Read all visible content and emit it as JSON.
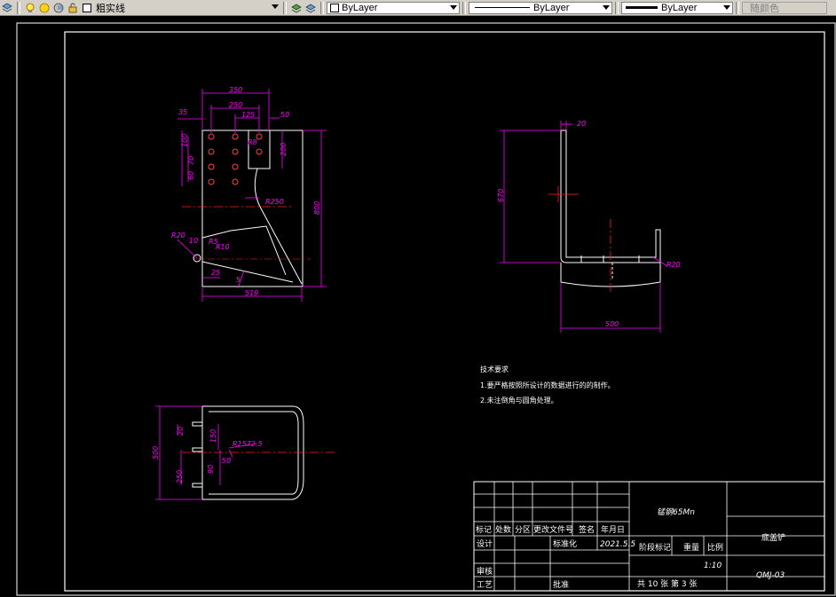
{
  "toolbar": {
    "linetype_name": "粗实线",
    "color_control": "ByLayer",
    "linetype_control": "ByLayer",
    "lineweight_control": "ByLayer",
    "plotstyle_control": "随颜色"
  },
  "view1": {
    "dims": {
      "d350": "350",
      "d250": "250",
      "d125": "125",
      "d50": "50",
      "d35": "35",
      "d100": "100",
      "d70": "70",
      "d60": "60",
      "d200": "200",
      "d800": "800",
      "d519": "519",
      "d25": "25",
      "d10": "10",
      "d5": "5",
      "r20": "R20",
      "r5": "R5",
      "r8": "R8",
      "r10": "R10",
      "r250": "R250"
    }
  },
  "view2": {
    "dims": {
      "d20": "20",
      "d670": "670",
      "d500": "500",
      "r20": "R20"
    }
  },
  "view3": {
    "dims": {
      "d500": "500",
      "d20": "20",
      "d150": "150",
      "d90": "90",
      "d250": "250",
      "d50": "50",
      "r": "R1572.5"
    }
  },
  "notes": {
    "title": "技术要求",
    "line1": "1.要严格按照所设计的数据进行的的制作。",
    "line2": "2.未注倒角与圆角处理。"
  },
  "titleblock": {
    "material": "锰钢65Mn",
    "part_name": "底盖铲",
    "drawing_no": "QMJ-03",
    "h_mark": "标记",
    "h_count": "处数",
    "h_zone": "分区",
    "h_docno": "更改文件号",
    "h_sign": "签名",
    "h_date": "年月日",
    "h_design": "设计",
    "h_standard": "标准化",
    "design_date": "2021.5.5",
    "h_stage": "阶段标记",
    "h_weight": "重量",
    "h_scale": "比例",
    "scale": "1:10",
    "h_check": "审核",
    "h_process": "工艺",
    "h_approve": "批准",
    "sheets": "共 10 张 第 3 张"
  }
}
